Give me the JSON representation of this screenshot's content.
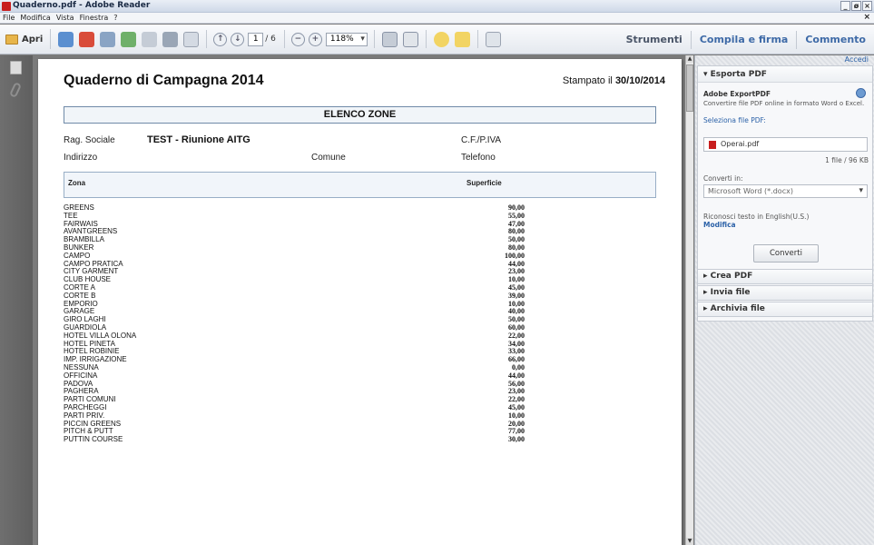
{
  "window": {
    "title": "Quaderno.pdf - Adobe Reader",
    "controls": [
      "_",
      "ø",
      "×"
    ],
    "doc_close": "×"
  },
  "menu": [
    "File",
    "Modifica",
    "Vista",
    "Finestra",
    "?"
  ],
  "toolbar": {
    "open_label": "Apri",
    "page_current": "1",
    "page_total": "/ 6",
    "zoom": "118%",
    "right_tabs": [
      "Strumenti",
      "Compila e firma",
      "Commento"
    ]
  },
  "document": {
    "title": "Quaderno di Campagna 2014",
    "printed_prefix": "Stampato il",
    "printed_date": "30/10/2014",
    "section_title": "ELENCO ZONE",
    "labels": {
      "rag_sociale": "Rag. Sociale",
      "rag_sociale_value": "TEST - Riunione AITG",
      "cf_piva": "C.F./P.IVA",
      "indirizzo": "Indirizzo",
      "comune": "Comune",
      "telefono": "Telefono"
    },
    "columns": {
      "zona": "Zona",
      "superficie": "Superficie"
    },
    "rows": [
      {
        "zona": "GREENS",
        "sup": "90,00"
      },
      {
        "zona": "TEE",
        "sup": "55,00"
      },
      {
        "zona": "FAIRWAIS",
        "sup": "47,00"
      },
      {
        "zona": "AVANTGREENS",
        "sup": "80,00"
      },
      {
        "zona": "BRAMBILLA",
        "sup": "50,00"
      },
      {
        "zona": "BUNKER",
        "sup": "80,00"
      },
      {
        "zona": "CAMPO",
        "sup": "100,00"
      },
      {
        "zona": "CAMPO PRATICA",
        "sup": "44,00"
      },
      {
        "zona": "CITY GARMENT",
        "sup": "23,00"
      },
      {
        "zona": "CLUB HOUSE",
        "sup": "10,00"
      },
      {
        "zona": "CORTE A",
        "sup": "45,00"
      },
      {
        "zona": "CORTE B",
        "sup": "39,00"
      },
      {
        "zona": "EMPORIO",
        "sup": "10,00"
      },
      {
        "zona": "GARAGE",
        "sup": "40,00"
      },
      {
        "zona": "GIRO LAGHI",
        "sup": "50,00"
      },
      {
        "zona": "GUARDIOLA",
        "sup": "60,00"
      },
      {
        "zona": "HOTEL VILLA OLONA",
        "sup": "22,00"
      },
      {
        "zona": "HOTEL PINETA",
        "sup": "34,00"
      },
      {
        "zona": "HOTEL ROBINIE",
        "sup": "33,00"
      },
      {
        "zona": "IMP. IRRIGAZIONE",
        "sup": "66,00"
      },
      {
        "zona": "NESSUNA",
        "sup": "0,00"
      },
      {
        "zona": "OFFICINA",
        "sup": "44,00"
      },
      {
        "zona": "PADOVA",
        "sup": "56,00"
      },
      {
        "zona": "PAGHERA",
        "sup": "23,00"
      },
      {
        "zona": "PARTI COMUNI",
        "sup": "22,00"
      },
      {
        "zona": "PARCHEGGI",
        "sup": "45,00"
      },
      {
        "zona": "PARTI PRIV.",
        "sup": "10,00"
      },
      {
        "zona": "PICCIN GREENS",
        "sup": "20,00"
      },
      {
        "zona": "PITCH & PUTT",
        "sup": "77,00"
      },
      {
        "zona": "PUTTIN COURSE",
        "sup": "30,00"
      }
    ]
  },
  "panel": {
    "accedi": "Accedi",
    "export_header": "▾  Esporta PDF",
    "export_title": "Adobe ExportPDF",
    "export_desc": "Convertire file PDF online in formato Word o Excel.",
    "select_label": "Seleziona file PDF:",
    "file_name": "Operai.pdf",
    "file_count": "1 file / 96 KB",
    "convert_label": "Converti in:",
    "convert_format": "Microsoft Word (*.docx)",
    "ocr_text": "Riconosci testo in English(U.S.)",
    "ocr_change": "Modifica",
    "convert_button": "Converti",
    "sections": [
      "▸  Crea PDF",
      "▸  Invia file",
      "▸  Archivia file"
    ]
  }
}
